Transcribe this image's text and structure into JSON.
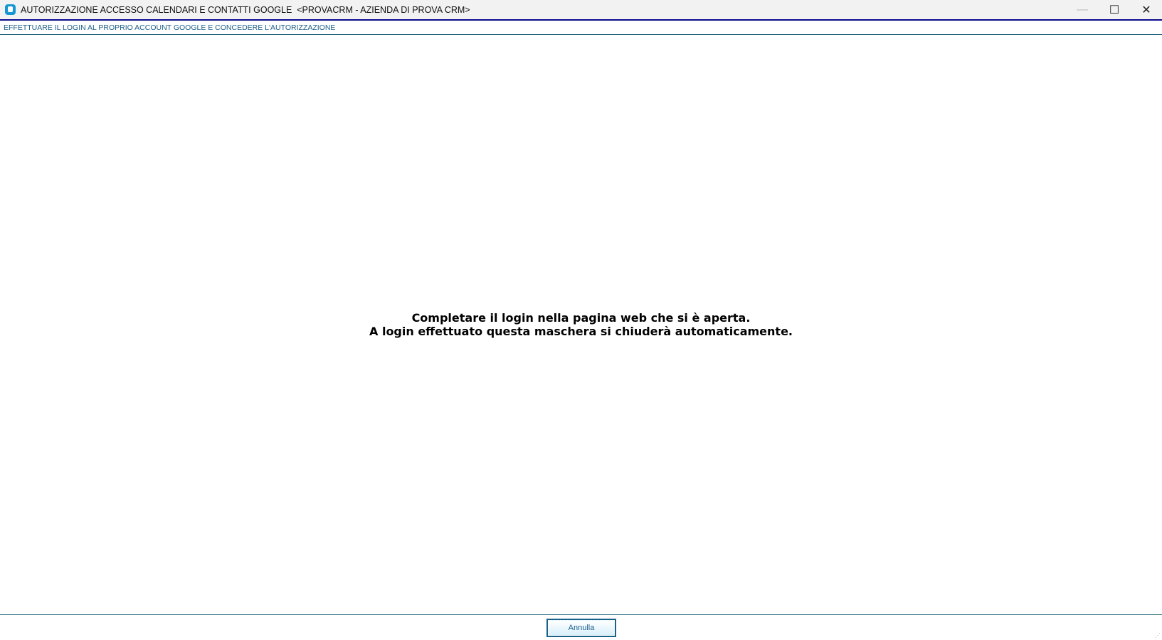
{
  "window": {
    "title": "AUTORIZZAZIONE ACCESSO CALENDARI E CONTATTI GOOGLE  <PROVACRM - AZIENDA DI PROVA CRM>",
    "minimize": "—",
    "maximize": "☐",
    "close": "✕"
  },
  "header": {
    "subtitle": "EFFETTUARE IL LOGIN AL PROPRIO ACCOUNT GOOGLE E CONCEDERE L'AUTORIZZAZIONE"
  },
  "main": {
    "line1": "Completare il login nella pagina web che si è aperta.",
    "line2": "A login effettuato questa maschera si chiuderà automaticamente."
  },
  "footer": {
    "cancel_label": "Annulla"
  }
}
